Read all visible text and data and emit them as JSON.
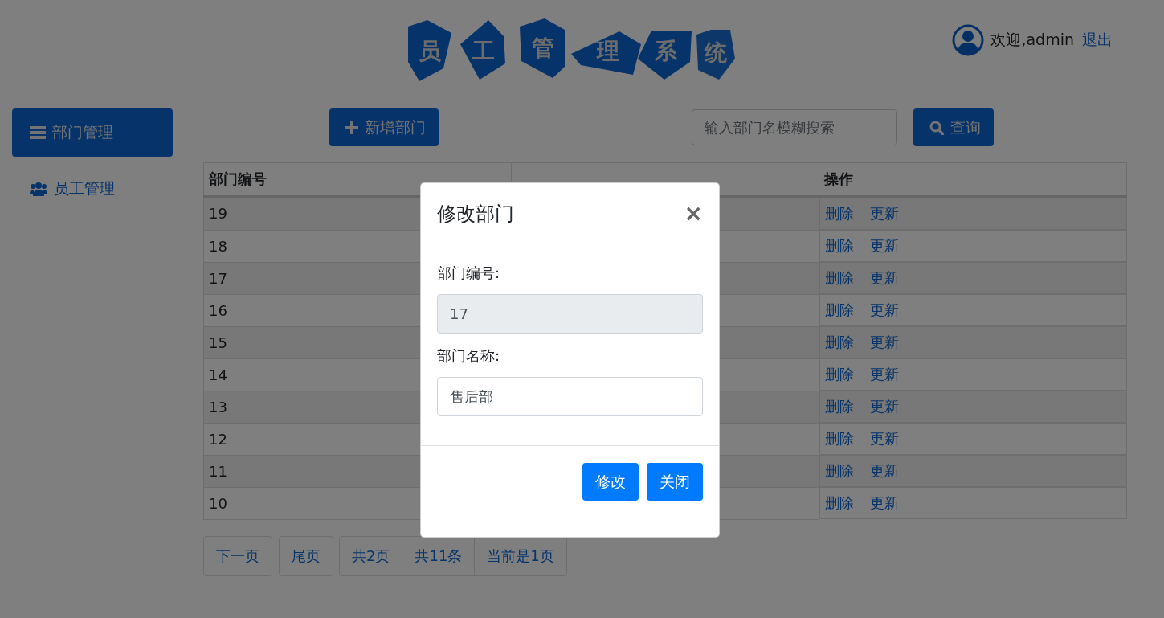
{
  "header": {
    "logo": [
      "员",
      "工",
      "管",
      "理",
      "系",
      "统"
    ],
    "welcome": "欢迎,admin",
    "logout": "退出"
  },
  "sidebar": {
    "items": [
      {
        "label": "部门管理",
        "selected": true
      },
      {
        "label": "员工管理",
        "selected": false
      }
    ]
  },
  "toolbar": {
    "add_button": "新增部门",
    "search": {
      "placeholder": "输入部门名模糊搜索"
    },
    "search_button": "查询"
  },
  "table": {
    "columns": {
      "id": "部门编号",
      "actions": "操作"
    },
    "rows": [
      {
        "id": "19",
        "actions": [
          "删除",
          "更新"
        ]
      },
      {
        "id": "18",
        "actions": [
          "删除",
          "更新"
        ]
      },
      {
        "id": "17",
        "actions": [
          "删除",
          "更新"
        ]
      },
      {
        "id": "16",
        "actions": [
          "删除",
          "更新"
        ]
      },
      {
        "id": "15",
        "actions": [
          "删除",
          "更新"
        ]
      },
      {
        "id": "14",
        "actions": [
          "删除",
          "更新"
        ]
      },
      {
        "id": "13",
        "actions": [
          "删除",
          "更新"
        ]
      },
      {
        "id": "12",
        "actions": [
          "删除",
          "更新"
        ]
      },
      {
        "id": "11",
        "actions": [
          "删除",
          "更新"
        ]
      },
      {
        "id": "10",
        "actions": [
          "删除",
          "更新"
        ]
      }
    ]
  },
  "pagination": {
    "links": [
      "下一页",
      "尾页"
    ],
    "info": [
      "共2页",
      "共11条",
      "当前是1页"
    ]
  },
  "modal": {
    "title": "修改部门",
    "close": "×",
    "fields": [
      {
        "label": "部门编号:",
        "value": "17",
        "disabled": true
      },
      {
        "label": "部门名称:",
        "value": "售后部",
        "disabled": false
      }
    ],
    "buttons": [
      "修改",
      "关闭"
    ]
  }
}
